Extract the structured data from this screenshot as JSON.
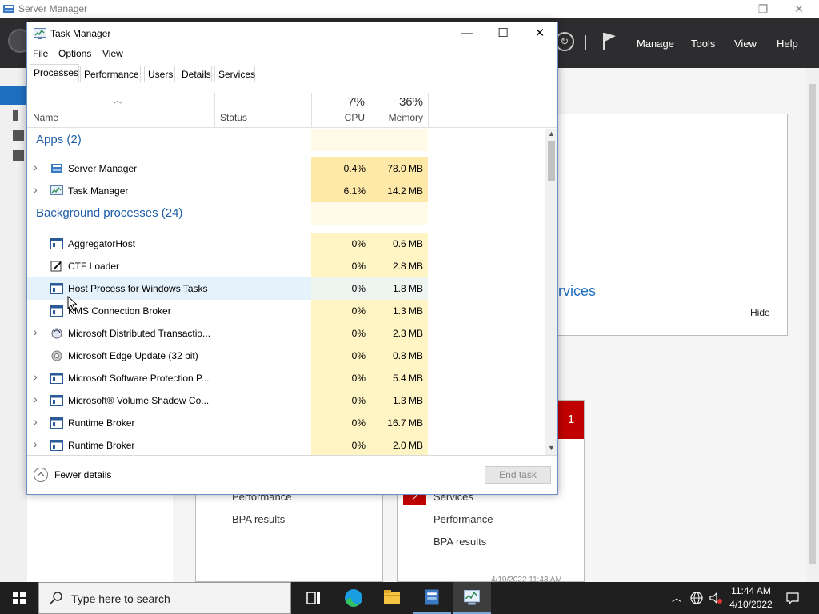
{
  "server_manager": {
    "title": "Server Manager",
    "window_controls": {
      "minimize": "—",
      "restore": "❐",
      "close": "✕"
    },
    "menu": [
      "Manage",
      "Tools",
      "View",
      "Help"
    ],
    "services_link": "rvices",
    "hide_label": "Hide",
    "badge_1": "1",
    "badge_2": "2",
    "left_card_items": [
      "Performance",
      "BPA results"
    ],
    "right_card_items": [
      "Services",
      "Performance",
      "BPA results"
    ],
    "timestamp": "4/10/2022 11:43 AM"
  },
  "task_manager": {
    "title": "Task Manager",
    "window_controls": {
      "minimize": "—",
      "maximize": "☐",
      "close": "✕"
    },
    "menu": [
      "File",
      "Options",
      "View"
    ],
    "tabs": [
      "Processes",
      "Performance",
      "Users",
      "Details",
      "Services"
    ],
    "active_tab": "Processes",
    "columns": {
      "name": "Name",
      "status": "Status",
      "cpu_pct": "7%",
      "cpu": "CPU",
      "mem_pct": "36%",
      "mem": "Memory"
    },
    "groups": {
      "apps": "Apps (2)",
      "background": "Background processes (24)"
    },
    "apps": [
      {
        "name": "Server Manager",
        "cpu": "0.4%",
        "mem": "78.0 MB",
        "expandable": true,
        "icon": "server-manager-icon"
      },
      {
        "name": "Task Manager",
        "cpu": "6.1%",
        "mem": "14.2 MB",
        "expandable": true,
        "icon": "task-manager-icon"
      }
    ],
    "background": [
      {
        "name": "AggregatorHost",
        "cpu": "0%",
        "mem": "0.6 MB",
        "expandable": false,
        "icon": "service-window-icon"
      },
      {
        "name": "CTF Loader",
        "cpu": "0%",
        "mem": "2.8 MB",
        "expandable": false,
        "icon": "ctf-loader-icon"
      },
      {
        "name": "Host Process for Windows Tasks",
        "cpu": "0%",
        "mem": "1.8 MB",
        "expandable": false,
        "icon": "service-window-icon"
      },
      {
        "name": "KMS Connection Broker",
        "cpu": "0%",
        "mem": "1.3 MB",
        "expandable": false,
        "icon": "service-window-icon"
      },
      {
        "name": "Microsoft Distributed Transactio...",
        "cpu": "0%",
        "mem": "2.3 MB",
        "expandable": true,
        "icon": "distributed-transaction-icon"
      },
      {
        "name": "Microsoft Edge Update (32 bit)",
        "cpu": "0%",
        "mem": "0.8 MB",
        "expandable": false,
        "icon": "edge-update-icon"
      },
      {
        "name": "Microsoft Software Protection P...",
        "cpu": "0%",
        "mem": "5.4 MB",
        "expandable": true,
        "icon": "service-window-icon"
      },
      {
        "name": "Microsoft® Volume Shadow Co...",
        "cpu": "0%",
        "mem": "1.3 MB",
        "expandable": true,
        "icon": "service-window-icon"
      },
      {
        "name": "Runtime Broker",
        "cpu": "0%",
        "mem": "16.7 MB",
        "expandable": true,
        "icon": "service-window-icon"
      },
      {
        "name": "Runtime Broker",
        "cpu": "0%",
        "mem": "2.0 MB",
        "expandable": true,
        "icon": "service-window-icon"
      }
    ],
    "fewer_details": "Fewer details",
    "end_task": "End task"
  },
  "taskbar": {
    "search_placeholder": "Type here to search",
    "time": "11:44 AM",
    "date": "4/10/2022"
  },
  "colors": {
    "accent": "#1e6fbf",
    "cpu_heat_light": "#fff4c4",
    "cpu_heat_mid": "#ffe9a8",
    "badge_red": "#c00000"
  }
}
